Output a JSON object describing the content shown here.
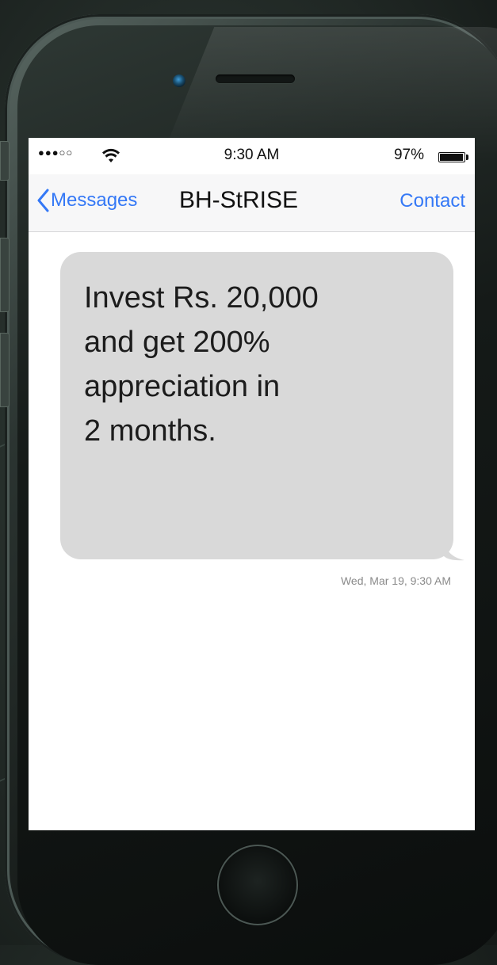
{
  "status_bar": {
    "signal": "●●●○○",
    "time": "9:30 AM",
    "battery_percent": "97%",
    "battery_level": 0.97
  },
  "nav": {
    "back_label": "Messages",
    "title": "BH-StRISE",
    "contact_label": "Contact"
  },
  "message": {
    "lines": [
      "Invest Rs. 20,000",
      "and get 200%",
      "appreciation in",
      "2 months."
    ],
    "timestamp": "Wed, Mar 19, 9:30 AM",
    "bubble_color": "#d9d9d9"
  },
  "colors": {
    "accent": "#3478f6",
    "device": "#1a201e"
  },
  "icons": {
    "wifi": "wifi-icon",
    "back": "chevron-left-icon",
    "battery": "battery-icon"
  }
}
